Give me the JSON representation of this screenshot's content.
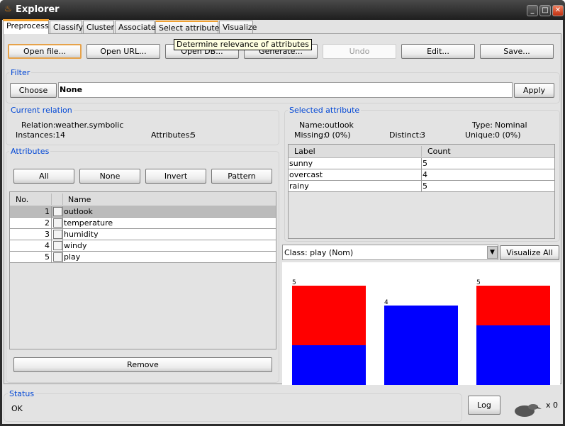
{
  "window": {
    "title": "Explorer",
    "icon": "java-cup-icon"
  },
  "tabs": [
    {
      "label": "Preprocess",
      "active": true
    },
    {
      "label": "Classify"
    },
    {
      "label": "Cluster"
    },
    {
      "label": "Associate"
    },
    {
      "label": "Select attributes"
    },
    {
      "label": "Visualize"
    }
  ],
  "tooltip": "Determine relevance of attributes",
  "toolbar": {
    "open_file": "Open file...",
    "open_url": "Open URL...",
    "open_db": "Open DB...",
    "generate": "Generate...",
    "undo": "Undo",
    "edit": "Edit...",
    "save": "Save..."
  },
  "filter": {
    "title": "Filter",
    "choose": "Choose",
    "value": "None",
    "apply": "Apply"
  },
  "relation": {
    "title": "Current relation",
    "relation_label": "Relation:",
    "relation_value": "weather.symbolic",
    "instances_label": "Instances:",
    "instances_value": "14",
    "attributes_label": "Attributes:",
    "attributes_value": "5"
  },
  "attributes": {
    "title": "Attributes",
    "all": "All",
    "none": "None",
    "invert": "Invert",
    "pattern": "Pattern",
    "col_no": "No.",
    "col_name": "Name",
    "rows": [
      {
        "no": "1",
        "name": "outlook",
        "selected": true
      },
      {
        "no": "2",
        "name": "temperature"
      },
      {
        "no": "3",
        "name": "humidity"
      },
      {
        "no": "4",
        "name": "windy"
      },
      {
        "no": "5",
        "name": "play"
      }
    ],
    "remove": "Remove"
  },
  "selected": {
    "title": "Selected attribute",
    "name_label": "Name:",
    "name_value": "outlook",
    "type_label": "Type:",
    "type_value": "Nominal",
    "missing_label": "Missing:",
    "missing_value": "0 (0%)",
    "distinct_label": "Distinct:",
    "distinct_value": "3",
    "unique_label": "Unique:",
    "unique_value": "0 (0%)",
    "col_label": "Label",
    "col_count": "Count",
    "rows": [
      {
        "label": "sunny",
        "count": "5"
      },
      {
        "label": "overcast",
        "count": "4"
      },
      {
        "label": "rainy",
        "count": "5"
      }
    ]
  },
  "class_select": {
    "value": "Class: play (Nom)",
    "visualize_all": "Visualize All"
  },
  "chart_data": {
    "type": "bar",
    "stacked": true,
    "categories": [
      "sunny",
      "overcast",
      "rainy"
    ],
    "totals": [
      "5",
      "4",
      "5"
    ],
    "series": [
      {
        "values": [
          2,
          4,
          3
        ],
        "color": "#0000ff"
      },
      {
        "values": [
          3,
          0,
          2
        ],
        "color": "#ff0000"
      }
    ],
    "ylim": [
      0,
      5
    ]
  },
  "status": {
    "title": "Status",
    "text": "OK",
    "log": "Log",
    "count": "x 0",
    "icon": "weka-bird-icon"
  }
}
